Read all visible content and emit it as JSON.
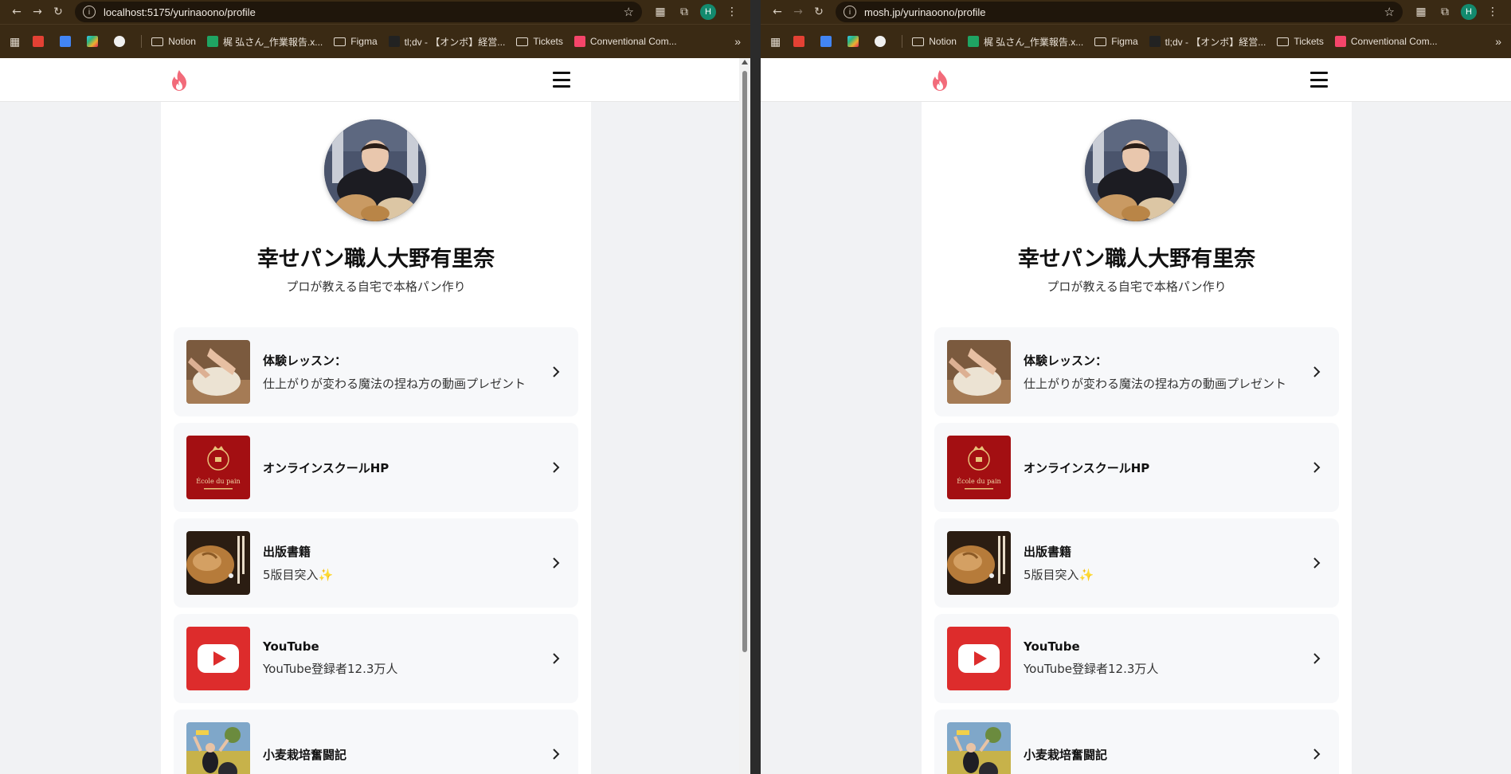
{
  "windows": [
    {
      "id": "left",
      "url": "localhost:5175/yurinaoono/profile",
      "avatar_letter": "H"
    },
    {
      "id": "right",
      "url": "mosh.jp/yurinaoono/profile",
      "avatar_letter": "H"
    }
  ],
  "bookmarks": [
    {
      "label": "Notion",
      "icon": "folder-icon"
    },
    {
      "label": "梶 弘さん_作業報告.x...",
      "icon": "sheets-icon"
    },
    {
      "label": "Figma",
      "icon": "folder-icon"
    },
    {
      "label": "tl;dv - 【オンボ】経営...",
      "icon": "tldv-icon"
    },
    {
      "label": "Tickets",
      "icon": "folder-icon"
    },
    {
      "label": "Conventional Com...",
      "icon": "bookmark-icon"
    }
  ],
  "profile": {
    "name": "幸せパン職人大野有里奈",
    "subtitle": "プロが教える自宅で本格パン作り"
  },
  "links": [
    {
      "title": "体験レッスン：",
      "desc": "仕上がりが変わる魔法の捏ね方の動画プレゼント",
      "thumb": "dough"
    },
    {
      "title": "オンラインスクールHP",
      "desc": "",
      "thumb": "ecole",
      "thumb_text": "École du pain"
    },
    {
      "title": "出版書籍",
      "desc": "5版目突入✨",
      "thumb": "book"
    },
    {
      "title": "YouTube",
      "desc": "YouTube登録者12.3万人",
      "thumb": "youtube"
    },
    {
      "title": "小麦栽培奮闘記",
      "desc": "",
      "thumb": "wheat"
    }
  ],
  "colors": {
    "chrome": "#3a2a14",
    "brand_flame": "#f26b7a",
    "youtube_red": "#dd2c2c",
    "ecole_red": "#a30f12"
  }
}
